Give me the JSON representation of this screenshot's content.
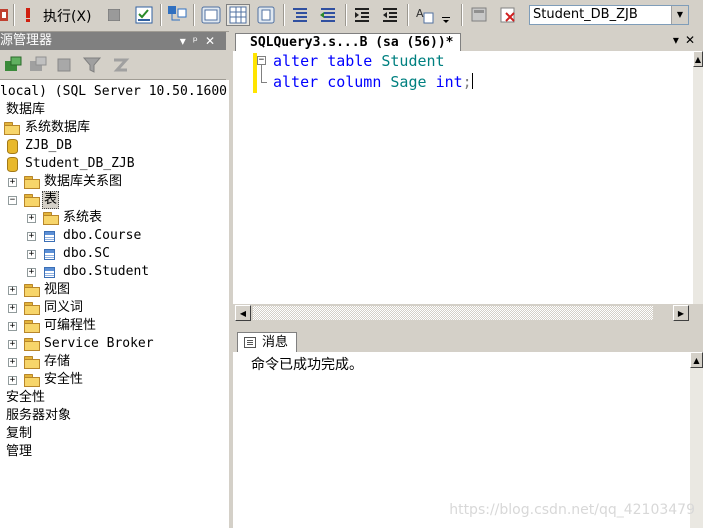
{
  "toolbar": {
    "execute_label": "执行(X)",
    "database": "Student_DB_ZJB"
  },
  "object_explorer": {
    "title": "源管理器",
    "server": "local) (SQL Server 10.50.1600",
    "nodes": {
      "databases": "数据库",
      "system_databases": "系统数据库",
      "zjb_db": "ZJB_DB",
      "student_db": "Student_DB_ZJB",
      "diagrams": "数据库关系图",
      "tables": "表",
      "system_tables": "系统表",
      "course": "dbo.Course",
      "sc": "dbo.SC",
      "student": "dbo.Student",
      "views": "视图",
      "synonyms": "同义词",
      "programmability": "可编程性",
      "service_broker": "Service Broker",
      "storage": "存储",
      "db_security": "安全性",
      "security": "安全性",
      "server_objects": "服务器对象",
      "replication": "复制",
      "management": "管理"
    }
  },
  "editor": {
    "tab_title": "SQLQuery3.s...B (sa (56))*",
    "line1": {
      "kw1": "alter",
      "kw2": "table",
      "ident": "Student"
    },
    "line2": {
      "kw1": "alter",
      "kw2": "column",
      "ident": "Sage",
      "type": "int",
      "punct": ";"
    }
  },
  "results": {
    "tab_label": "消息",
    "message": "命令已成功完成。"
  },
  "watermark": "https://blog.csdn.net/qq_42103479"
}
